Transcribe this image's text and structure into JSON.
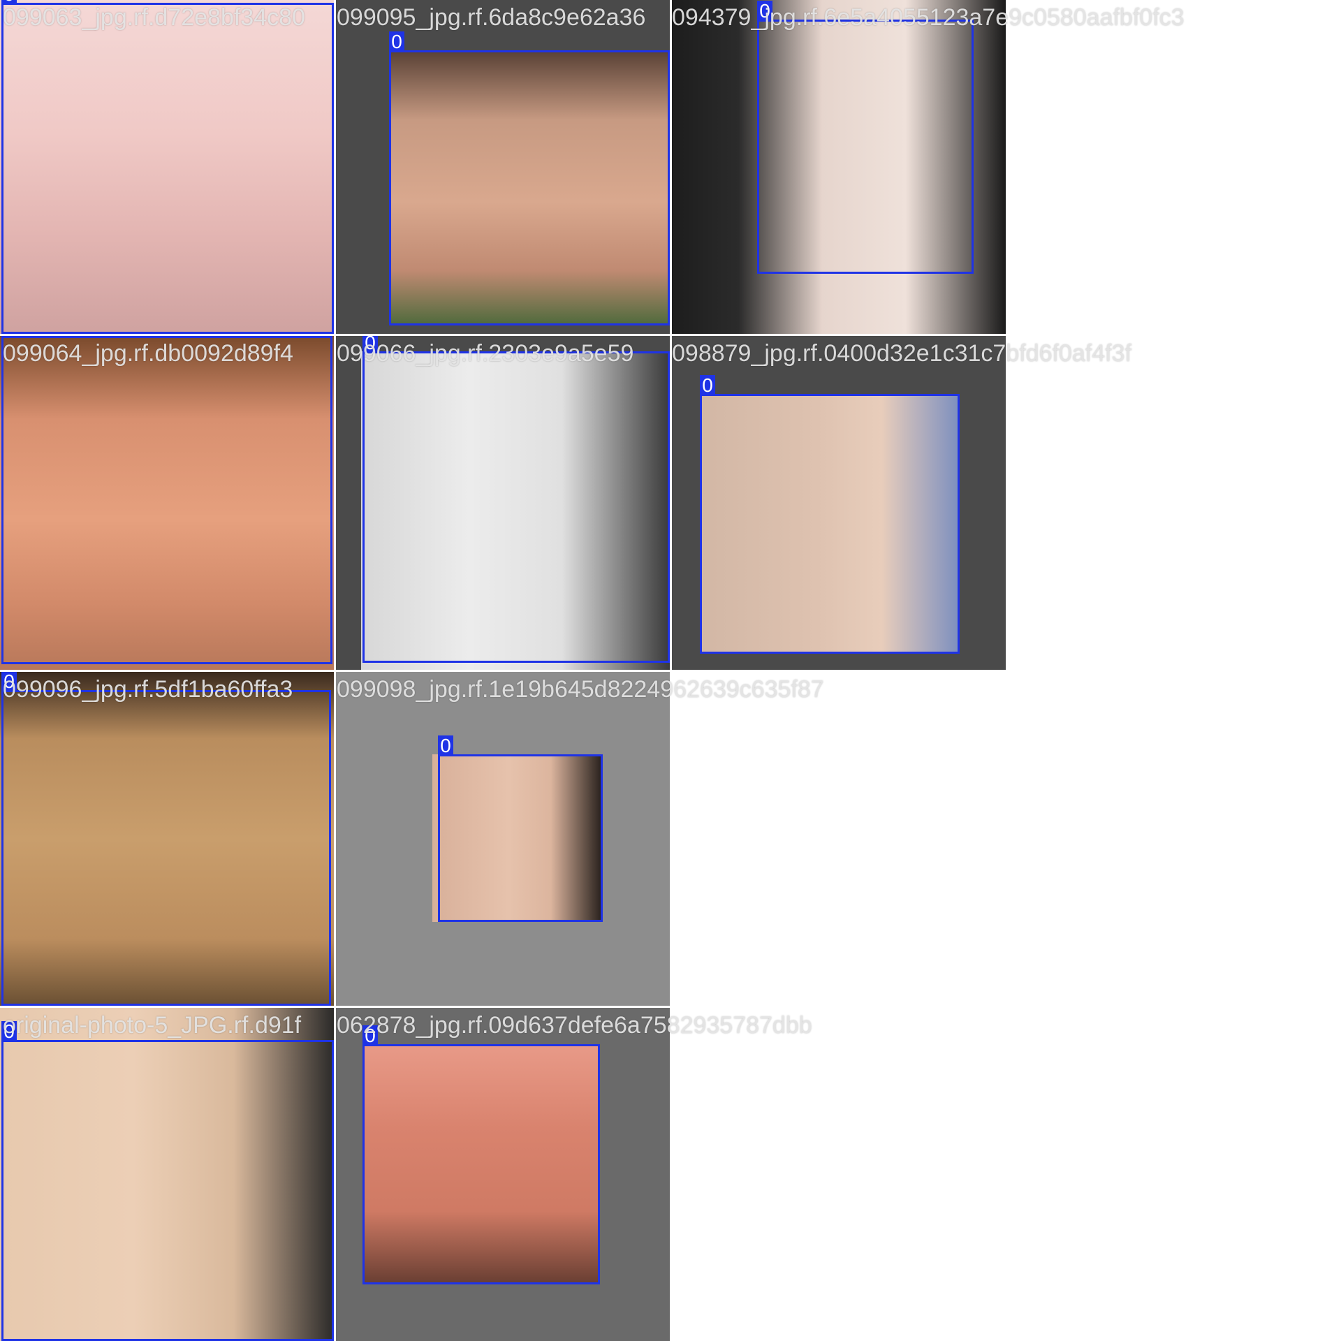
{
  "mosaic": {
    "accent_color": "#1f33e6",
    "tiles": [
      {
        "id": "tile-1",
        "filename": "099063_jpg.rf.d72e8bf34c80",
        "class_label": "0",
        "pad_color": "#e8c6c6",
        "photo_bg": "linear-gradient(180deg,#f4d8d6 0%,#f0c9c6 40%,#e3b5b2 70%,#cfa2a0 100%)",
        "orientation": "upside-down"
      },
      {
        "id": "tile-2",
        "filename": "099095_jpg.rf.6da8c9e62a36",
        "class_label": "0",
        "pad_color": "#4a4a4a",
        "photo_bg": "linear-gradient(180deg,#5a4236 0%,#c79a82 25%,#d9a88e 55%,#c08a72 80%,#4e6a3c 100%)",
        "orientation": "upright"
      },
      {
        "id": "tile-3",
        "filename": "094379_jpg.rf.6e5a4055123a7e9c0580aafbf0fc3",
        "class_label": "0",
        "pad_color": "#ffffff",
        "photo_bg": "linear-gradient(90deg,#1d1d1d 0%,#2b2b2b 20%,#e6d5cd 45%,#efe1da 70%,#1a1a1a 100%)",
        "orientation": "rotated"
      },
      {
        "id": "tile-4",
        "filename": "099064_jpg.rf.db0092d89f4",
        "class_label": "0",
        "pad_color": "#f6e8f2",
        "photo_bg": "linear-gradient(180deg,#7a4a2c 0%,#d89070 25%,#e6a07e 55%,#d28a6a 80%,#b8785a 100%)",
        "orientation": "upright"
      },
      {
        "id": "tile-5",
        "filename": "099066_jpg.rf.2303e9a5e59",
        "class_label": "0",
        "pad_color": "#4a4a4a",
        "photo_bg": "linear-gradient(90deg,#d7d7d7 0%,#ececec 35%,#e0e0e0 65%,#3a3a3a 100%)",
        "orientation": "rotated"
      },
      {
        "id": "tile-6",
        "filename": "098879_jpg.rf.0400d32e1c31c7bfd6f0af4f3f",
        "class_label": "0",
        "pad_color": "#4a4a4a",
        "photo_bg": "linear-gradient(90deg,#d2b7a5 0%,#dec2b0 45%,#e8cdbb 70%,#7c8fbf 100%)",
        "orientation": "rotated"
      },
      {
        "id": "tile-7",
        "filename": "099096_jpg.rf.5df1ba60ffa3",
        "class_label": "0",
        "pad_color": "#2d2018",
        "photo_bg": "linear-gradient(180deg,#3a2a1e 0%,#b98d5e 20%,#c99e6c 50%,#bb8d5e 80%,#6a5033 100%)",
        "orientation": "upright"
      },
      {
        "id": "tile-8",
        "filename": "099098_jpg.rf.1e19b645d8224962639c635f87",
        "class_label": "0",
        "pad_color": "#8d8d8d",
        "photo_bg": "linear-gradient(90deg,#d8b09a 0%,#e6c2ac 45%,#dcb59e 70%,#2a221e 100%)",
        "orientation": "rotated"
      },
      {
        "id": "tile-9",
        "filename": "original-photo-5_JPG.rf.d91f",
        "class_label": "0",
        "pad_color": "#5f7580",
        "photo_bg": "linear-gradient(90deg,#e7c9ae 0%,#eccfb6 40%,#d9b99c 70%,#2b2a29 100%)",
        "orientation": "rotated"
      },
      {
        "id": "tile-10",
        "filename": "062878_jpg.rf.09d637defe6a7582935787dbb",
        "class_label": "0",
        "pad_color": "#6a6a6a",
        "photo_bg": "linear-gradient(180deg,#e89a88 0%,#d9836e 35%,#cf7a64 70%,#6a3f33 100%)",
        "orientation": "upside-down"
      }
    ]
  }
}
